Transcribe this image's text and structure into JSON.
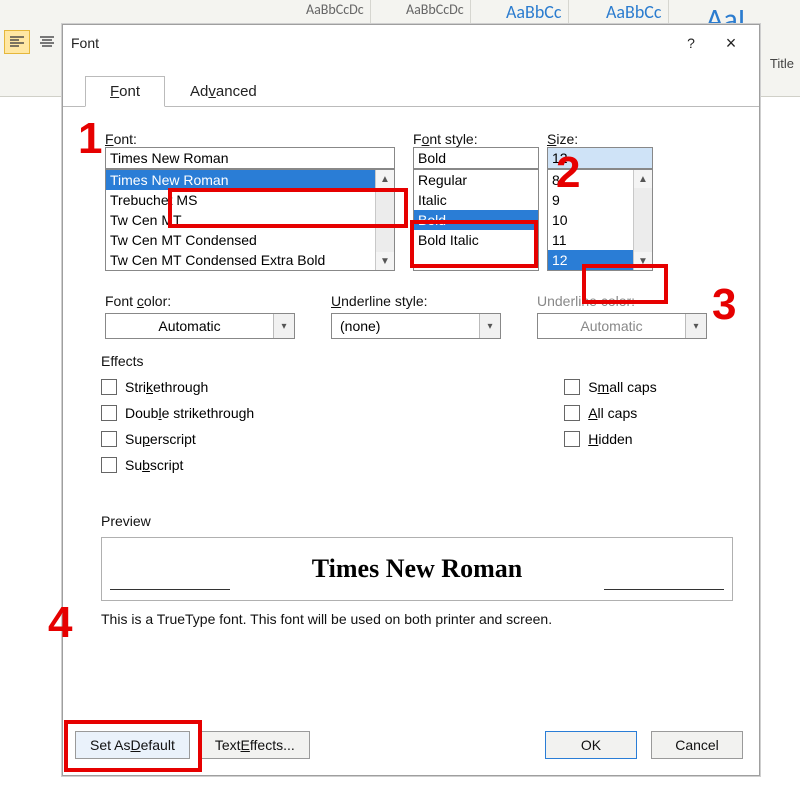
{
  "background_ribbon": {
    "styles": [
      "AaBbCcDc",
      "AaBbCcDc",
      "AaBbCc",
      "AaBbCc",
      "AaI"
    ],
    "title_label": "Title"
  },
  "dialog": {
    "title": "Font",
    "help_icon": "?",
    "close_icon": "×",
    "tabs": {
      "font": "Font",
      "advanced": "Advanced"
    },
    "labels": {
      "font": "Font:",
      "font_style": "Font style:",
      "size": "Size:",
      "font_color": "Font color:",
      "underline_style": "Underline style:",
      "underline_color": "Underline color:",
      "effects": "Effects",
      "preview": "Preview"
    },
    "font": {
      "value": "Times New Roman",
      "items": [
        "Times New Roman",
        "Trebuchet MS",
        "Tw Cen MT",
        "Tw Cen MT Condensed",
        "Tw Cen MT Condensed Extra Bold"
      ],
      "selected_index": 0
    },
    "font_style": {
      "value": "Bold",
      "items": [
        "Regular",
        "Italic",
        "Bold",
        "Bold Italic"
      ],
      "selected_index": 2
    },
    "size": {
      "value": "12",
      "items": [
        "8",
        "9",
        "10",
        "11",
        "12"
      ],
      "selected_index": 4
    },
    "font_color": {
      "value": "Automatic"
    },
    "underline_style": {
      "value": "(none)"
    },
    "underline_color": {
      "value": "Automatic"
    },
    "effects_list": {
      "left": [
        "Strikethrough",
        "Double strikethrough",
        "Superscript",
        "Subscript"
      ],
      "right": [
        "Small caps",
        "All caps",
        "Hidden"
      ]
    },
    "preview_text": "Times New Roman",
    "hint": "This is a TrueType font. This font will be used on both printer and screen.",
    "buttons": {
      "default": "Set As Default",
      "text_effects": "Text Effects...",
      "ok": "OK",
      "cancel": "Cancel"
    }
  },
  "annotations": {
    "n1": "1",
    "n2": "2",
    "n3": "3",
    "n4": "4"
  },
  "colors": {
    "selection": "#2a7dd6",
    "annotation": "#e60000",
    "ok_border": "#2a7dd6"
  }
}
